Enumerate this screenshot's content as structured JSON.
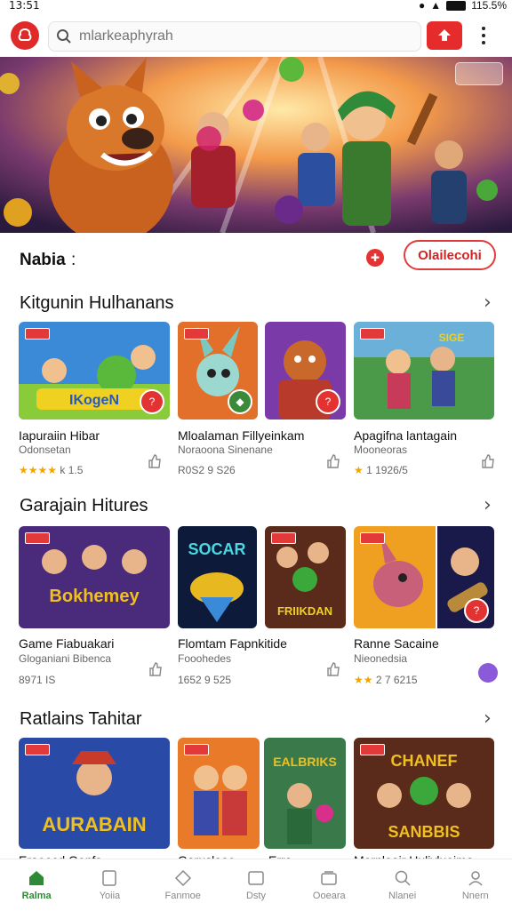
{
  "status": {
    "time": "13:51",
    "battery": "115.5%"
  },
  "search": {
    "placeholder": "mlarkeaphyrah"
  },
  "filter": {
    "label": "Nabia",
    "colon": ":",
    "button_label": "Olailecohi"
  },
  "sections": [
    {
      "title": "Kitgunin Hulhanans",
      "items": [
        {
          "title": "Iapuraiin Hibar",
          "subtitle": "Odonsetan",
          "meta": "k 1.5",
          "stars": "★★★★"
        },
        {
          "title": "Mloalaman Fillyeinkam",
          "subtitle": "Noraoona Sinenane",
          "meta": "R0S2 9 S26",
          "stars": ""
        },
        {
          "title": "Apagifna lantagain",
          "subtitle": "Mooneoras",
          "meta": "1 1926/5",
          "stars": "★"
        }
      ]
    },
    {
      "title": "Garajain Hitures",
      "items": [
        {
          "title": "Game Fiabuakari",
          "subtitle": "Gloganiani Bibenca",
          "meta": "8971 IS",
          "stars": ""
        },
        {
          "title": "Flomtam Fapnkitide",
          "subtitle": "Fooohedes",
          "meta": "1652 9 525",
          "stars": ""
        },
        {
          "title": "Ranne Sacaine",
          "subtitle": "Nieonedsia",
          "meta": "2 7 6215",
          "stars": "★★"
        }
      ]
    },
    {
      "title": "Ratlains Tahitar",
      "items": [
        {
          "title": "Eraeecd Genfs",
          "subtitle": "",
          "meta": "",
          "stars": ""
        },
        {
          "title": "Garuslaac",
          "subtitle": "",
          "meta": "",
          "stars": ""
        },
        {
          "title": "Erra",
          "subtitle": "",
          "meta": "",
          "stars": ""
        },
        {
          "title": "Mernlaair Huliyluoima",
          "subtitle": "",
          "meta": "",
          "stars": ""
        }
      ]
    }
  ],
  "nav": [
    "Ralma",
    "Yoiia",
    "Fanmoe",
    "Dsty",
    "Ooeara",
    "Nlanei",
    "Nnern"
  ],
  "colors": {
    "accent": "#e02a2a",
    "nav_active": "#2f8a36",
    "star": "#f0a500"
  }
}
